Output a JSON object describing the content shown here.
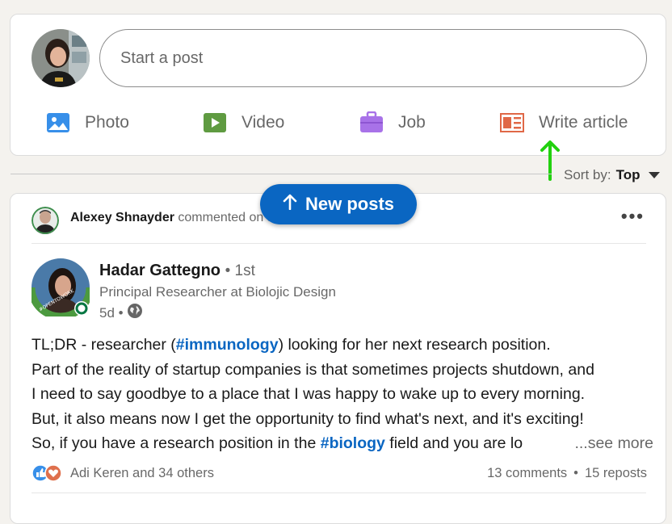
{
  "composer": {
    "placeholder": "Start a post",
    "actions": [
      {
        "label": "Photo",
        "icon": "photo-icon",
        "color": "#378fe9"
      },
      {
        "label": "Video",
        "icon": "video-icon",
        "color": "#5f9b41"
      },
      {
        "label": "Job",
        "icon": "briefcase-icon",
        "color": "#a872e8"
      },
      {
        "label": "Write article",
        "icon": "article-icon",
        "color": "#e06847"
      }
    ]
  },
  "sort": {
    "label": "Sort by:",
    "value": "Top"
  },
  "new_posts": {
    "label": "New posts"
  },
  "feed_post": {
    "activity": {
      "actor": "Alexey Shnayder",
      "action": "commented on this"
    },
    "author": {
      "name": "Hadar Gattegno",
      "degree": "• 1st",
      "headline": "Principal Researcher at Biolojic Design",
      "time": "5d •",
      "badge": "#OPENTOWORK"
    },
    "body": {
      "line1_pre": "TL;DR - researcher (",
      "line1_tag": "#immunology",
      "line1_post": ") looking for her next research position.",
      "line2": "Part of the reality of startup companies is that sometimes projects shutdown, and",
      "line3": "I need to say goodbye to a place that I was happy to wake up to every morning.",
      "line4": "But, it also means now I get the opportunity to find what's next, and it's exciting!",
      "line5_pre": "So, if you have a research position in the ",
      "line5_tag": "#biology",
      "line5_post": " field and you are lo",
      "see_more": "...see more"
    },
    "social": {
      "reactions": "Adi Keren and 34 others",
      "comments": "13 comments",
      "separator": "•",
      "reposts": "15 reposts"
    }
  },
  "colors": {
    "brand": "#0a66c2",
    "annotation_arrow": "#22d10f",
    "open_to_work": "#057642"
  }
}
